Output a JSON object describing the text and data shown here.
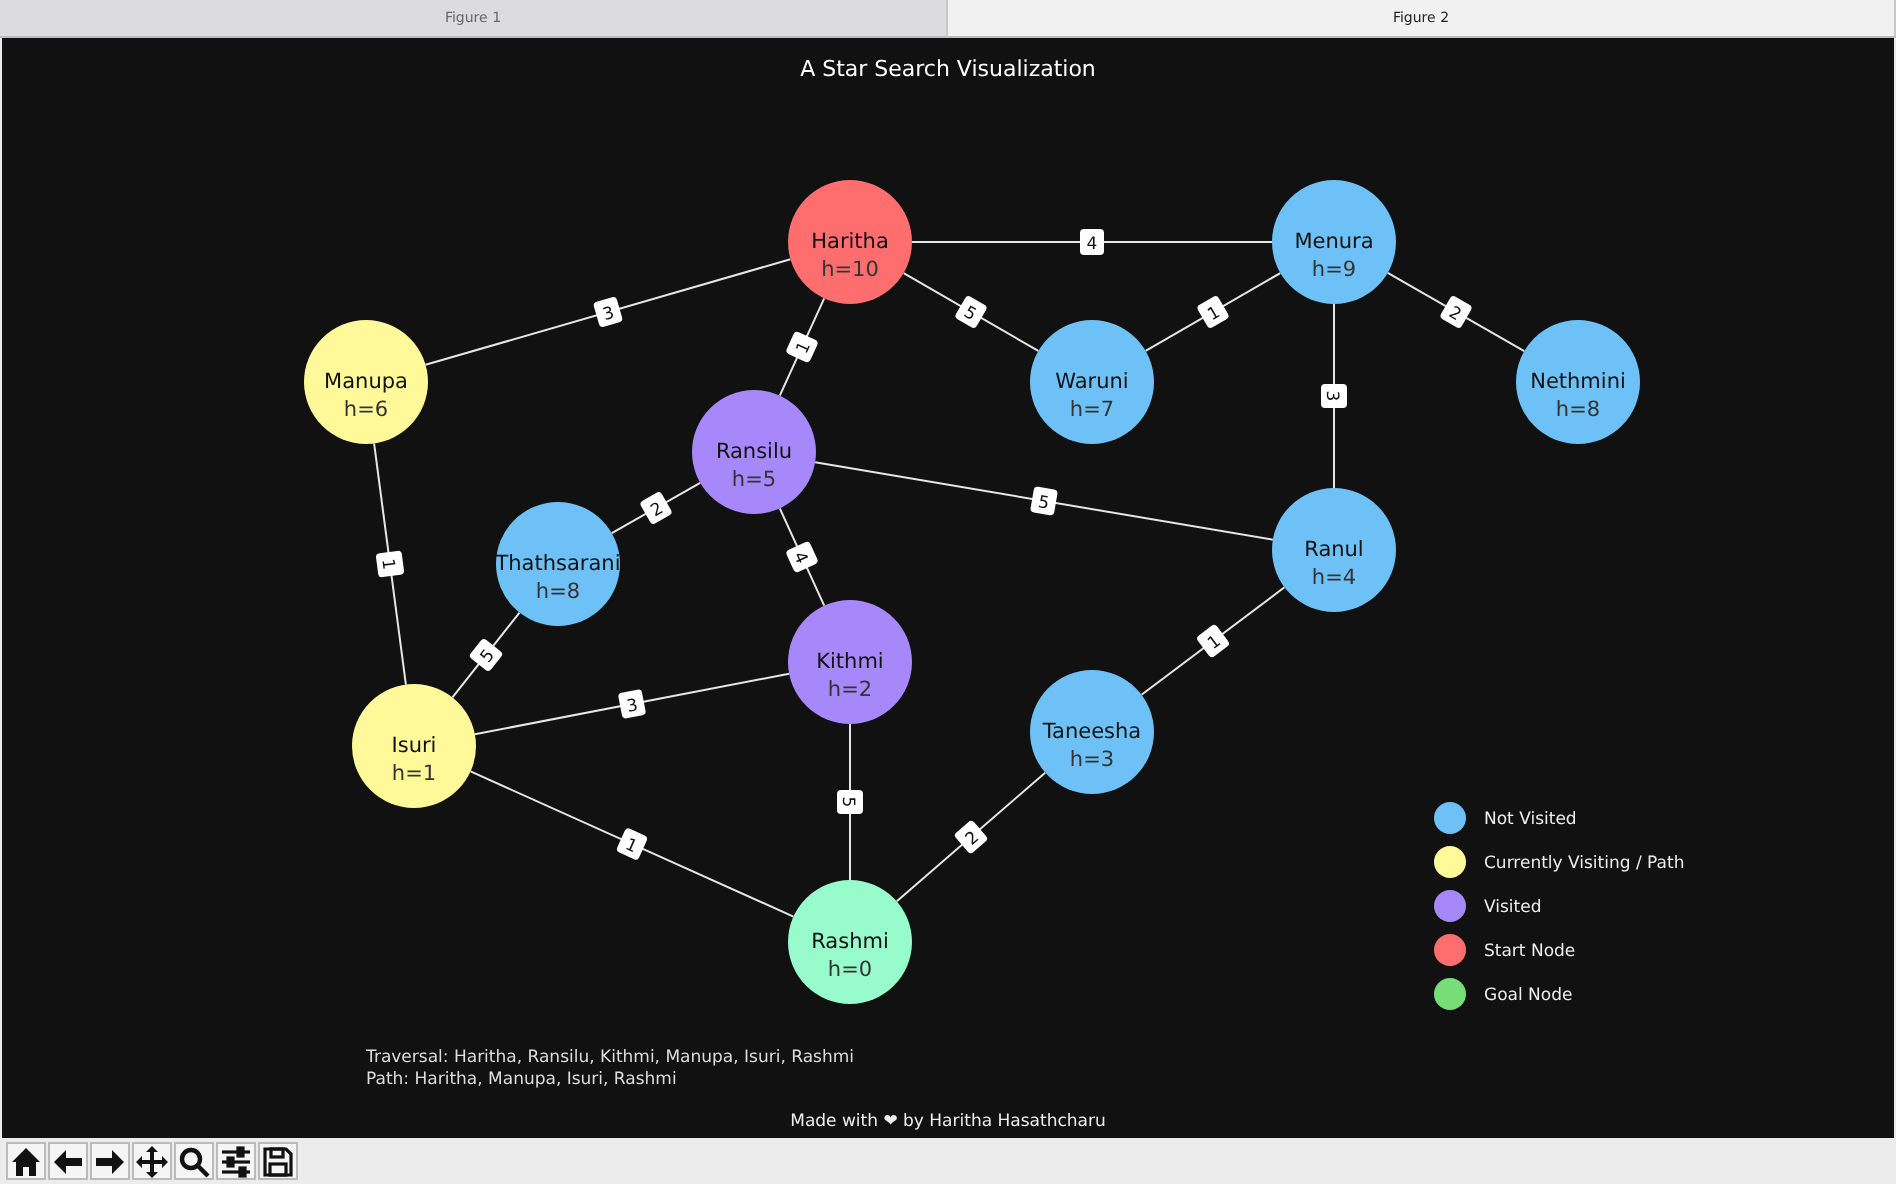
{
  "tabs": [
    {
      "label": "Figure 1",
      "selected": false
    },
    {
      "label": "Figure 2",
      "selected": true
    }
  ],
  "figure": {
    "title": "A Star Search Visualization",
    "nodes": [
      {
        "name": "Haritha",
        "h": "h=10",
        "color": "#ff6e6e"
      },
      {
        "name": "Menura",
        "h": "h=9",
        "color": "#6ec1f7"
      },
      {
        "name": "Manupa",
        "h": "h=6",
        "color": "#fff99a"
      },
      {
        "name": "Waruni",
        "h": "h=7",
        "color": "#6ec1f7"
      },
      {
        "name": "Nethmini",
        "h": "h=8",
        "color": "#6ec1f7"
      },
      {
        "name": "Ransilu",
        "h": "h=5",
        "color": "#a688fa"
      },
      {
        "name": "Thathsarani",
        "h": "h=8",
        "color": "#6ec1f7"
      },
      {
        "name": "Ranul",
        "h": "h=4",
        "color": "#6ec1f7"
      },
      {
        "name": "Kithmi",
        "h": "h=2",
        "color": "#a688fa"
      },
      {
        "name": "Taneesha",
        "h": "h=3",
        "color": "#6ec1f7"
      },
      {
        "name": "Isuri",
        "h": "h=1",
        "color": "#fff99a"
      },
      {
        "name": "Rashmi",
        "h": "h=0",
        "color": "#98fbcb"
      }
    ],
    "edges": [
      {
        "weight": "4"
      },
      {
        "weight": "3"
      },
      {
        "weight": "5"
      },
      {
        "weight": "1"
      },
      {
        "weight": "1"
      },
      {
        "weight": "2"
      },
      {
        "weight": "3"
      },
      {
        "weight": "5"
      },
      {
        "weight": "2"
      },
      {
        "weight": "4"
      },
      {
        "weight": "1"
      },
      {
        "weight": "5"
      },
      {
        "weight": "3"
      },
      {
        "weight": "1"
      },
      {
        "weight": "5"
      },
      {
        "weight": "1"
      },
      {
        "weight": "2"
      }
    ],
    "legend": [
      {
        "label": "Not Visited",
        "color": "#6ec1f7"
      },
      {
        "label": "Currently Visiting / Path",
        "color": "#fff99a"
      },
      {
        "label": "Visited",
        "color": "#a688fa"
      },
      {
        "label": "Start Node",
        "color": "#ff6e6e"
      },
      {
        "label": "Goal Node",
        "color": "#77dd77"
      }
    ],
    "traversal": "Traversal: Haritha, Ransilu, Kithmi, Manupa, Isuri, Rashmi",
    "path": "Path: Haritha, Manupa, Isuri, Rashmi",
    "footer": "Made with ❤ by Haritha Hasathcharu"
  }
}
